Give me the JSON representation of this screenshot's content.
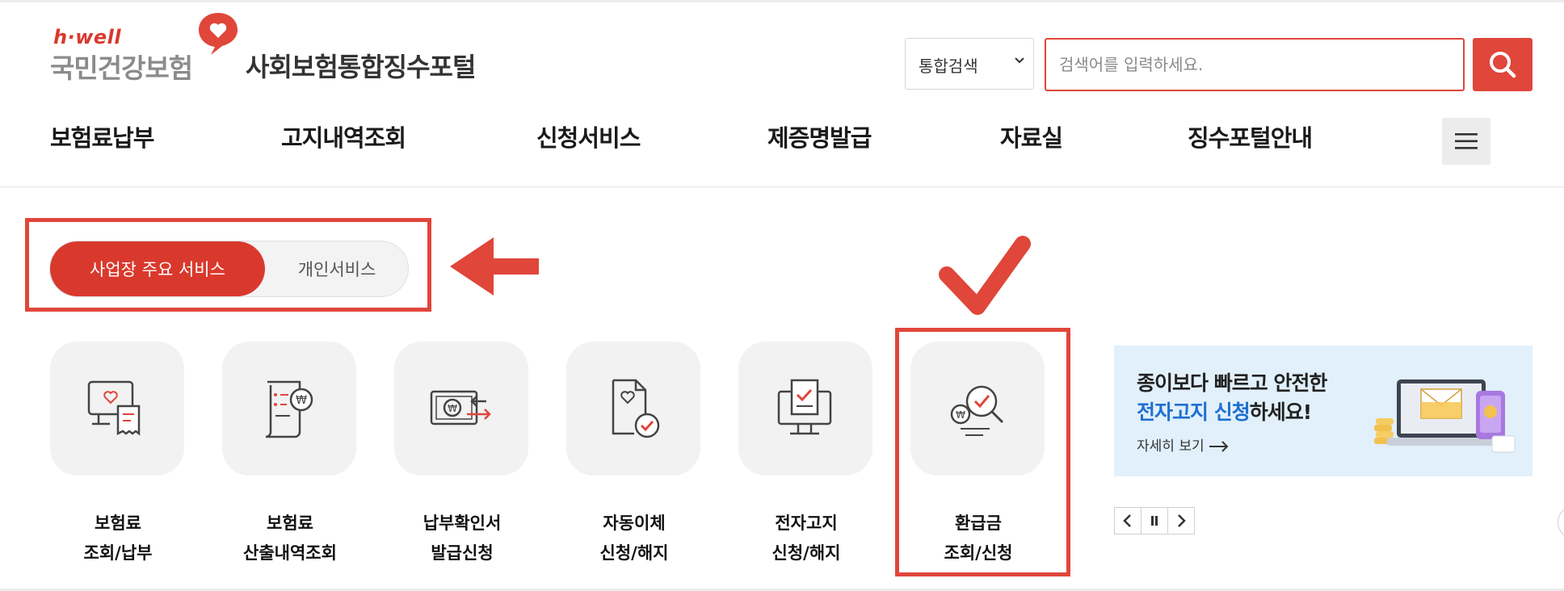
{
  "brand": {
    "hwell": "h·well",
    "nhis": "국민건강보험",
    "portal": "사회보험통합징수포털"
  },
  "search": {
    "select_value": "통합검색",
    "placeholder": "검색어를 입력하세요.",
    "button_icon": "search-icon"
  },
  "gnb": {
    "items": [
      "보험료납부",
      "고지내역조회",
      "신청서비스",
      "제증명발급",
      "자료실",
      "징수포털안내"
    ],
    "menu_icon": "hamburger-icon"
  },
  "service_toggle": {
    "active": "사업장 주요 서비스",
    "inactive": "개인서비스"
  },
  "services": [
    {
      "line1": "보험료",
      "line2": "조회/납부",
      "icon": "bill-monitor-icon"
    },
    {
      "line1": "보험료",
      "line2": "산출내역조회",
      "icon": "calculation-document-icon"
    },
    {
      "line1": "납부확인서",
      "line2": "발급신청",
      "icon": "payment-certificate-icon"
    },
    {
      "line1": "자동이체",
      "line2": "신청/해지",
      "icon": "auto-transfer-document-icon"
    },
    {
      "line1": "전자고지",
      "line2": "신청/해지",
      "icon": "electronic-notice-monitor-icon"
    },
    {
      "line1": "환급금",
      "line2": "조회/신청",
      "icon": "refund-search-icon"
    }
  ],
  "banner": {
    "line1": "종이보다 빠르고 안전한",
    "line2_highlight": "전자고지 신청",
    "line2_rest": "하세요!",
    "more": "자세히 보기"
  },
  "colors": {
    "accent": "#e0463a",
    "toggle_active": "#d9392d",
    "tile_bg": "#f2f2f2",
    "banner_bg": "#e1f0fb",
    "banner_highlight": "#1f6fd1"
  }
}
